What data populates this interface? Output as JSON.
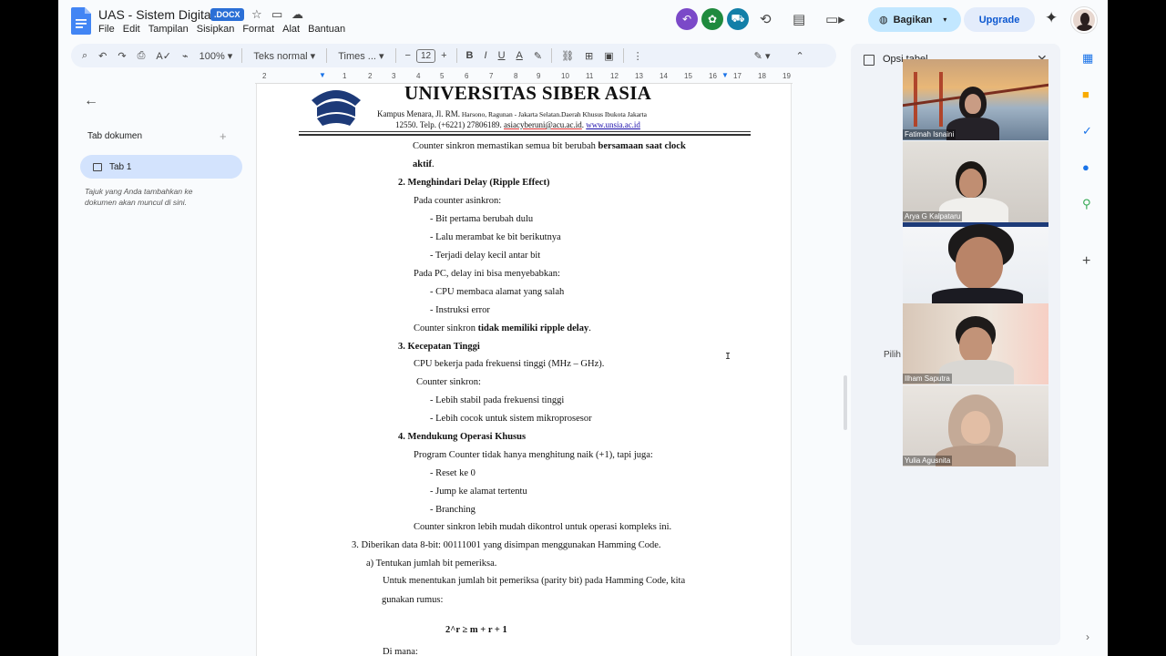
{
  "app": {
    "doc_title": "UAS - Sistem Digital",
    "badge": ".DOCX",
    "menu": [
      "File",
      "Edit",
      "Tampilan",
      "Sisipkan",
      "Format",
      "Alat",
      "Bantuan"
    ],
    "share_label": "Bagikan",
    "upgrade_label": "Upgrade"
  },
  "toolbar": {
    "zoom": "100%",
    "style": "Teks normal",
    "font": "Times ...",
    "font_size": "12"
  },
  "ruler": [
    "2",
    "1",
    "1",
    "2",
    "3",
    "4",
    "5",
    "6",
    "7",
    "8",
    "9",
    "10",
    "11",
    "12",
    "13",
    "14",
    "15",
    "16",
    "17",
    "18",
    "19"
  ],
  "left_panel": {
    "tab_header": "Tab dokumen",
    "tab1": "Tab 1",
    "hint": "Tajuk yang Anda tambahkan ke dokumen akan muncul di sini."
  },
  "letterhead": {
    "name": "UNIVERSITAS SIBER ASIA",
    "addr1_a": "Kampus Menara, Jl. RM.",
    "addr1_b": " Harsono, Ragunan - Jakarta Selatan.Daerah Khusus Ibukota Jakarta",
    "addr2_a": "12550. Telp. (+6221) 27806189. ",
    "addr2_mail": "asiacyberuni@acu.ac.id",
    "addr2_sep": ". ",
    "addr2_web": "www.unsia.ac.id"
  },
  "doc": {
    "l1a": "Counter sinkron memastikan semua bit berubah ",
    "l1b": "bersamaan saat clock",
    "l2": "aktif",
    "l2_end": ".",
    "h2": "2.   Menghindari Delay (Ripple Effect)",
    "l3": "Pada counter asinkron:",
    "b1": "-     Bit pertama berubah dulu",
    "b2": "-     Lalu merambat ke bit berikutnya",
    "b3": "-     Terjadi delay kecil antar bit",
    "l4": "Pada PC, delay ini bisa menyebabkan:",
    "b4": "-     CPU membaca alamat yang salah",
    "b5": "-     Instruksi error",
    "l5a": "Counter sinkron ",
    "l5b": "tidak memiliki ripple delay",
    "l5c": ".",
    "h3": "3.   Kecepatan Tinggi",
    "l6": "CPU bekerja pada frekuensi tinggi (MHz – GHz).",
    "l7": "Counter sinkron:",
    "b6": "-     Lebih stabil pada frekuensi tinggi",
    "b7": "-     Lebih cocok untuk sistem mikroprosesor",
    "h4": "4.   Mendukung Operasi Khusus",
    "l8": "Program Counter tidak hanya menghitung naik (+1), tapi juga:",
    "b8": "-     Reset ke 0",
    "b9": "-     Jump ke alamat tertentu",
    "b10": "-     Branching",
    "l9": "Counter sinkron lebih mudah dikontrol untuk operasi kompleks ini.",
    "q3": "3.   Diberikan data 8-bit: 00111001 yang disimpan menggunakan Hamming Code.",
    "qa": "a)   Tentukan jumlah bit pemeriksa.",
    "l10": "Untuk menentukan jumlah bit pemeriksa (parity bit) pada Hamming Code, kita",
    "l11": "gunakan rumus:",
    "formula": "2^r ≥ m + r + 1",
    "l12": "Di mana:"
  },
  "right_panel": {
    "title": "Opsi tabel",
    "pilih": "Pilih"
  },
  "participants": [
    "Fatimah Isnaini",
    "Arya G Kalpataru",
    "Ilham Saputra",
    "Yulia Agusnita"
  ],
  "colors": {
    "accent": "#0b57d0",
    "share_bg": "#c2e7ff",
    "tab_active": "#d3e3fd",
    "docx_badge": "#2b6fd6",
    "link": "#1a0dab"
  }
}
